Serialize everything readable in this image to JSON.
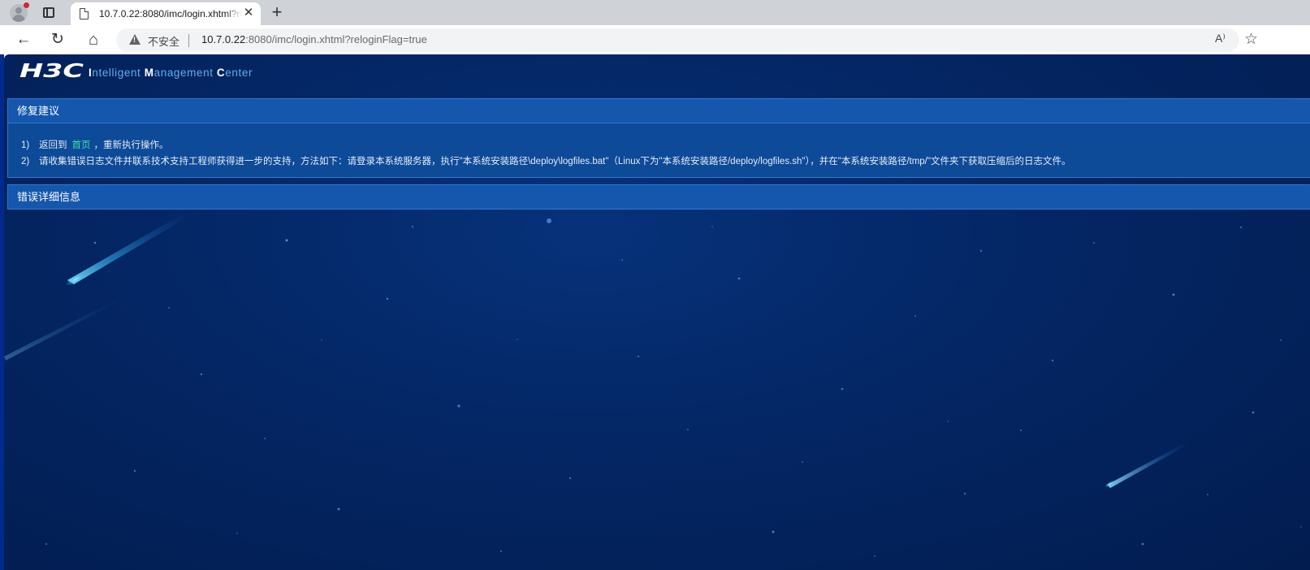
{
  "browser": {
    "tab_title": "10.7.0.22:8080/imc/login.xhtml?reloginFlag=true",
    "tab_close": "✕",
    "new_tab": "+",
    "back": "←",
    "reload": "↻",
    "home": "⌂",
    "security_label": "不安全",
    "url_host": "10.7.0.22",
    "url_rest": ":8080/imc/login.xhtml?reloginFlag=true",
    "read_aloud": "A⁾",
    "favorite": "☆",
    "icons": [
      "profile-icon",
      "tab-actions-icon",
      "page-icon",
      "close-icon",
      "plus-icon",
      "back-arrow-icon",
      "reload-icon",
      "home-icon",
      "warning-icon",
      "read-aloud-icon",
      "star-icon"
    ]
  },
  "header": {
    "logo_text": "H3C",
    "product_segments": [
      {
        "cap": "I",
        "rest": "ntelligent "
      },
      {
        "cap": "M",
        "rest": "anagement "
      },
      {
        "cap": "C",
        "rest": "enter"
      }
    ]
  },
  "suggestions": {
    "title": "修复建议",
    "item1_num": "1)",
    "item1_before": "返回到",
    "item1_link": "首页",
    "item1_after": "，重新执行操作。",
    "item2_num": "2)",
    "item2_text": "请收集错误日志文件并联系技术支持工程师获得进一步的支持，方法如下：请登录本系统服务器，执行\"本系统安装路径\\deploy\\logfiles.bat\"（Linux下为\"本系统安装路径/deploy/logfiles.sh\"），并在\"本系统安装路径/tmp/\"文件夹下获取压缩后的日志文件。"
  },
  "details": {
    "title": "错误详细信息"
  },
  "colors": {
    "page_background": "#042766",
    "panel_header": "#1457ad",
    "panel_body": "#0d4a98",
    "link": "#3ee0a8",
    "product_text": "#5fb1ec"
  }
}
